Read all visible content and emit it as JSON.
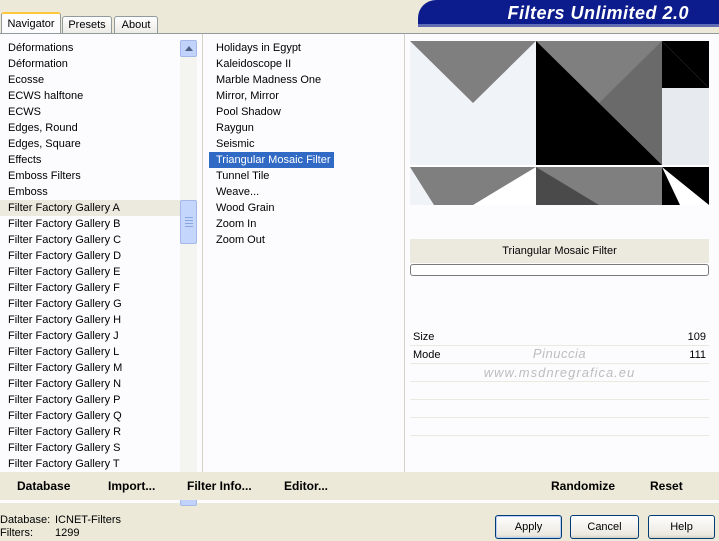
{
  "tabs": [
    {
      "label": "Navigator",
      "active": true
    },
    {
      "label": "Presets",
      "active": false
    },
    {
      "label": "About",
      "active": false
    }
  ],
  "banner_title": "Filters Unlimited 2.0",
  "categories": [
    "Déformations",
    "Déformation",
    "Ecosse",
    "ECWS halftone",
    "ECWS",
    "Edges, Round",
    "Edges, Square",
    "Effects",
    "Emboss Filters",
    "Emboss",
    "Filter Factory Gallery A",
    "Filter Factory Gallery B",
    "Filter Factory Gallery C",
    "Filter Factory Gallery D",
    "Filter Factory Gallery E",
    "Filter Factory Gallery F",
    "Filter Factory Gallery G",
    "Filter Factory Gallery H",
    "Filter Factory Gallery J",
    "Filter Factory Gallery L",
    "Filter Factory Gallery M",
    "Filter Factory Gallery N",
    "Filter Factory Gallery P",
    "Filter Factory Gallery Q",
    "Filter Factory Gallery R",
    "Filter Factory Gallery S",
    "Filter Factory Gallery T"
  ],
  "selected_category": "Filter Factory Gallery A",
  "filters": [
    "Holidays in Egypt",
    "Kaleidoscope II",
    "Marble Madness One",
    "Mirror, Mirror",
    "Pool Shadow",
    "Raygun",
    "Seismic",
    "Triangular Mosaic Filter",
    "Tunnel Tile",
    "Weave...",
    "Wood Grain",
    "Zoom In",
    "Zoom Out"
  ],
  "selected_filter": "Triangular Mosaic Filter",
  "current_filter_title": "Triangular Mosaic Filter",
  "controls": [
    {
      "label": "Size",
      "value": "109"
    },
    {
      "label": "Mode",
      "value": "111"
    }
  ],
  "watermark": {
    "line1": "Pinuccia",
    "line2": "www.msdnregrafica.eu"
  },
  "toolbar": {
    "database": "Database",
    "import": "Import...",
    "filter_info": "Filter Info...",
    "editor": "Editor...",
    "randomize": "Randomize",
    "reset": "Reset"
  },
  "status": {
    "database_label": "Database:",
    "database_value": "ICNET-Filters",
    "filters_label": "Filters:",
    "filters_value": "1299"
  },
  "buttons": {
    "apply": "Apply",
    "cancel": "Cancel",
    "help": "Help"
  },
  "colors": {
    "selection": "#316ac5",
    "banner": "#0c1c8c",
    "preview_gray": "#7f7f7f",
    "preview_light": "#f0f3f7",
    "preview_black": "#000000"
  }
}
